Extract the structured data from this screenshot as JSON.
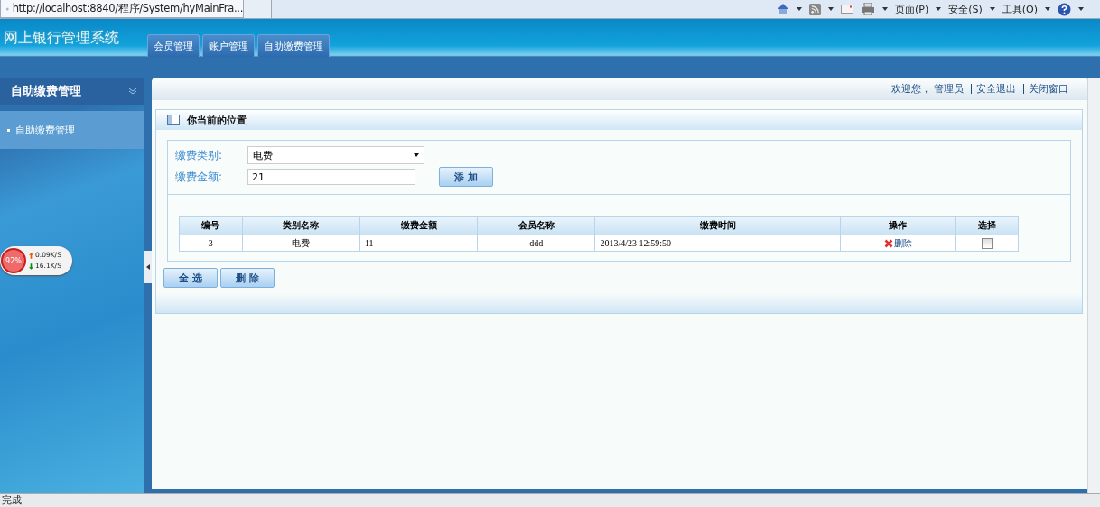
{
  "browser": {
    "tab_title": "http://localhost:8840/程序/System/hyMainFra...",
    "commands": [
      "页面(P)",
      "安全(S)",
      "工具(O)"
    ]
  },
  "header": {
    "title": "网上银行管理系统",
    "tabs": [
      {
        "label": "会员管理",
        "selected": false
      },
      {
        "label": "账户管理",
        "selected": false
      },
      {
        "label": "自助缴费管理",
        "selected": false
      }
    ]
  },
  "sidebar": {
    "title": "自助缴费管理",
    "items": [
      {
        "label": "自助缴费管理",
        "selected": true
      }
    ]
  },
  "topbar": {
    "welcome": "欢迎您，",
    "user": "管理员",
    "links": [
      "安全退出",
      "关闭窗口"
    ]
  },
  "panel": {
    "title": "你当前的位置",
    "form": {
      "category_label": "缴费类别:",
      "category_value": "电费",
      "amount_label": "缴费金额:",
      "amount_value": "21",
      "add_button": "添 加"
    },
    "table": {
      "columns": [
        "编号",
        "类别名称",
        "缴费金额",
        "会员名称",
        "缴费时间",
        "操作",
        "选择"
      ],
      "rows": [
        {
          "cells": [
            "3",
            "电费",
            "11",
            "ddd",
            "2013/4/23 12:59:50"
          ],
          "action": "删除",
          "checked": false
        }
      ]
    },
    "buttons": [
      "全 选",
      "删 除"
    ]
  },
  "net_widget": {
    "percent": "92%",
    "up": "0.09K/S",
    "down": "16.1K/S"
  },
  "status_bar": {
    "text": "完成"
  }
}
